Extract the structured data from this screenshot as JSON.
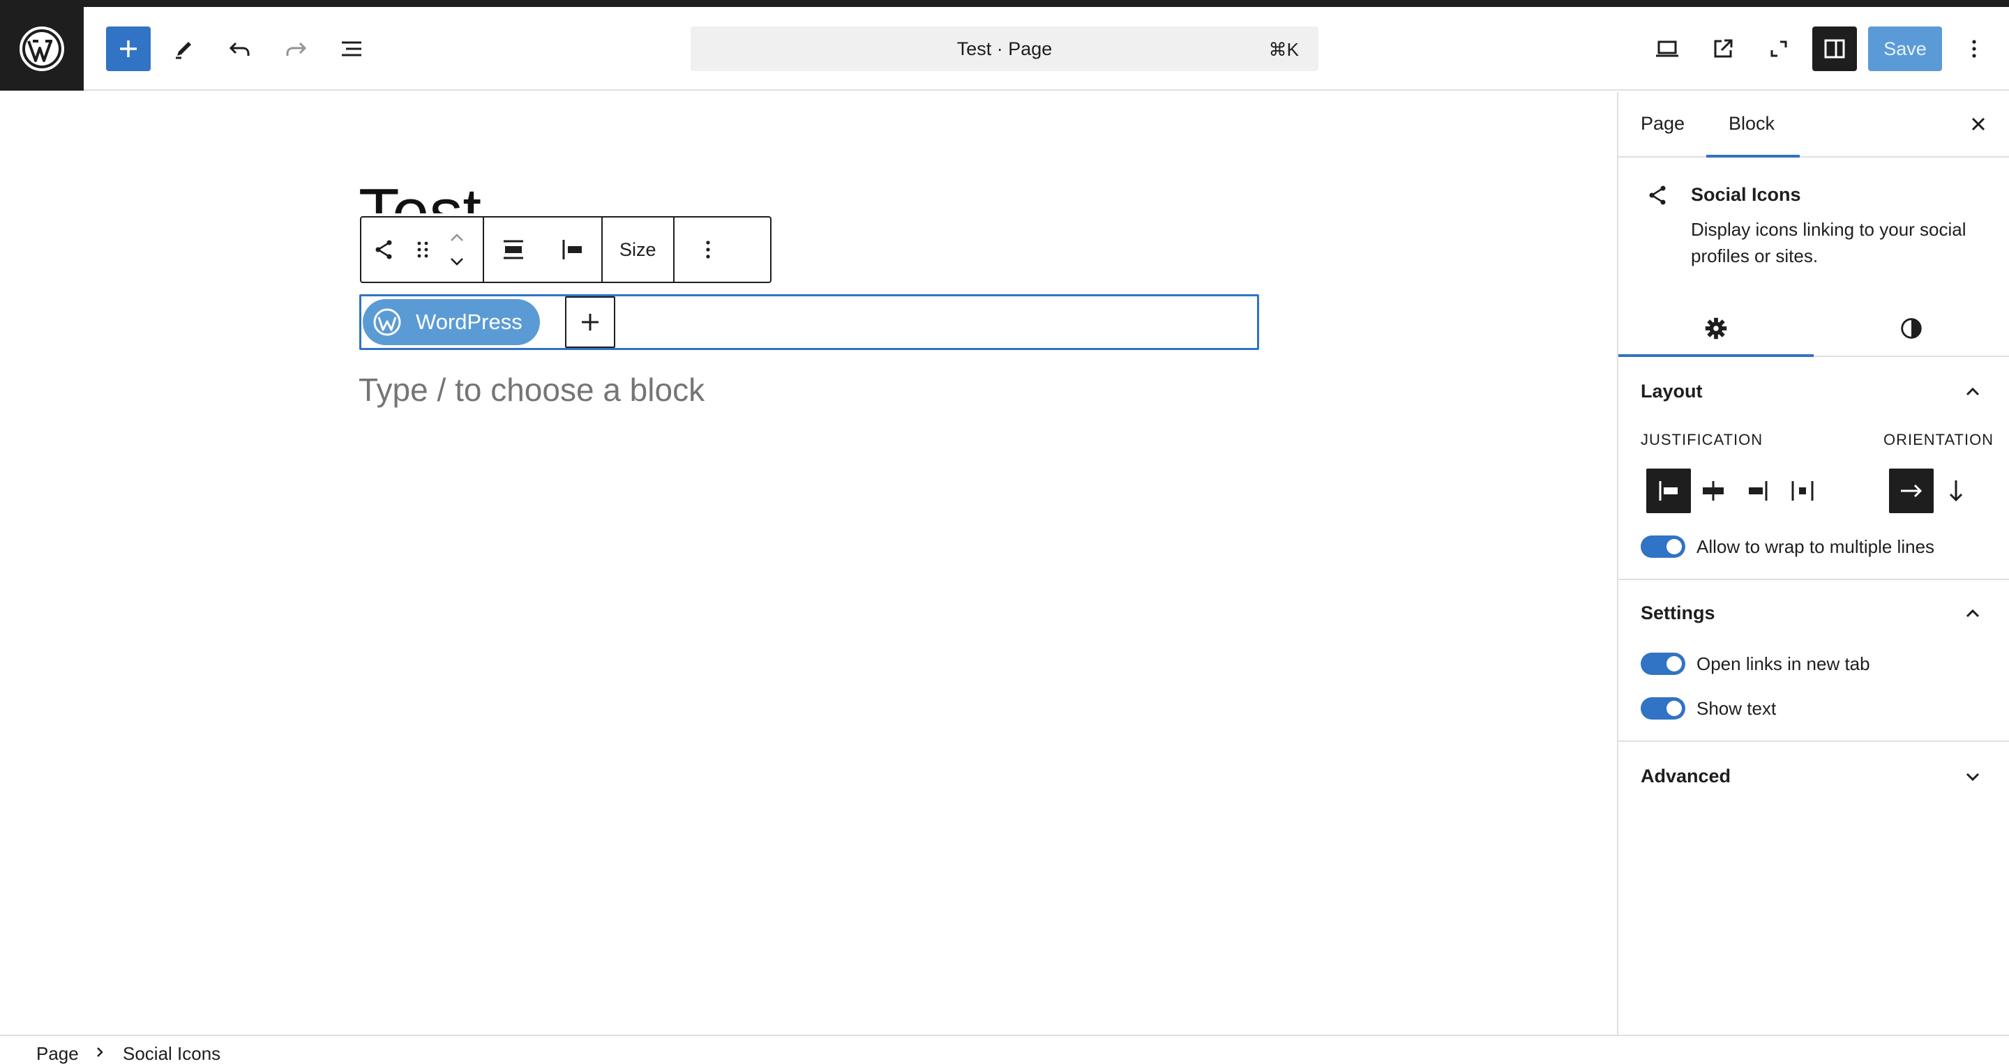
{
  "header": {
    "command_title": "Test · Page",
    "command_shortcut": "⌘K",
    "save_label": "Save",
    "icons": [
      "wordpress-logo-icon",
      "plus-icon",
      "pencil-icon",
      "undo-icon",
      "redo-icon",
      "list-view-icon",
      "desktop-preview-icon",
      "external-link-icon",
      "fullscreen-icon",
      "sidebar-toggle-icon",
      "more-vertical-icon"
    ]
  },
  "editor": {
    "page_title": "Test",
    "toolbar_size_label": "Size",
    "social_link_label": "WordPress",
    "placeholder": "Type / to choose a block"
  },
  "sidebar": {
    "tabs": [
      "Page",
      "Block"
    ],
    "active_tab": "Block",
    "block": {
      "name": "Social Icons",
      "description": "Display icons linking to your social profiles or sites."
    },
    "layout": {
      "title": "Layout",
      "justification_label": "JUSTIFICATION",
      "orientation_label": "ORIENTATION",
      "wrap_label": "Allow to wrap to multiple lines",
      "wrap_enabled": true
    },
    "settings": {
      "title": "Settings",
      "open_new_tab_label": "Open links in new tab",
      "open_new_tab_enabled": true,
      "show_text_label": "Show text",
      "show_text_enabled": true
    },
    "advanced": {
      "title": "Advanced"
    }
  },
  "breadcrumb": [
    "Page",
    "Social Icons"
  ],
  "colors": {
    "accent": "#3173c4",
    "save_button": "#5a9bd7",
    "dark": "#1e1e1e"
  }
}
